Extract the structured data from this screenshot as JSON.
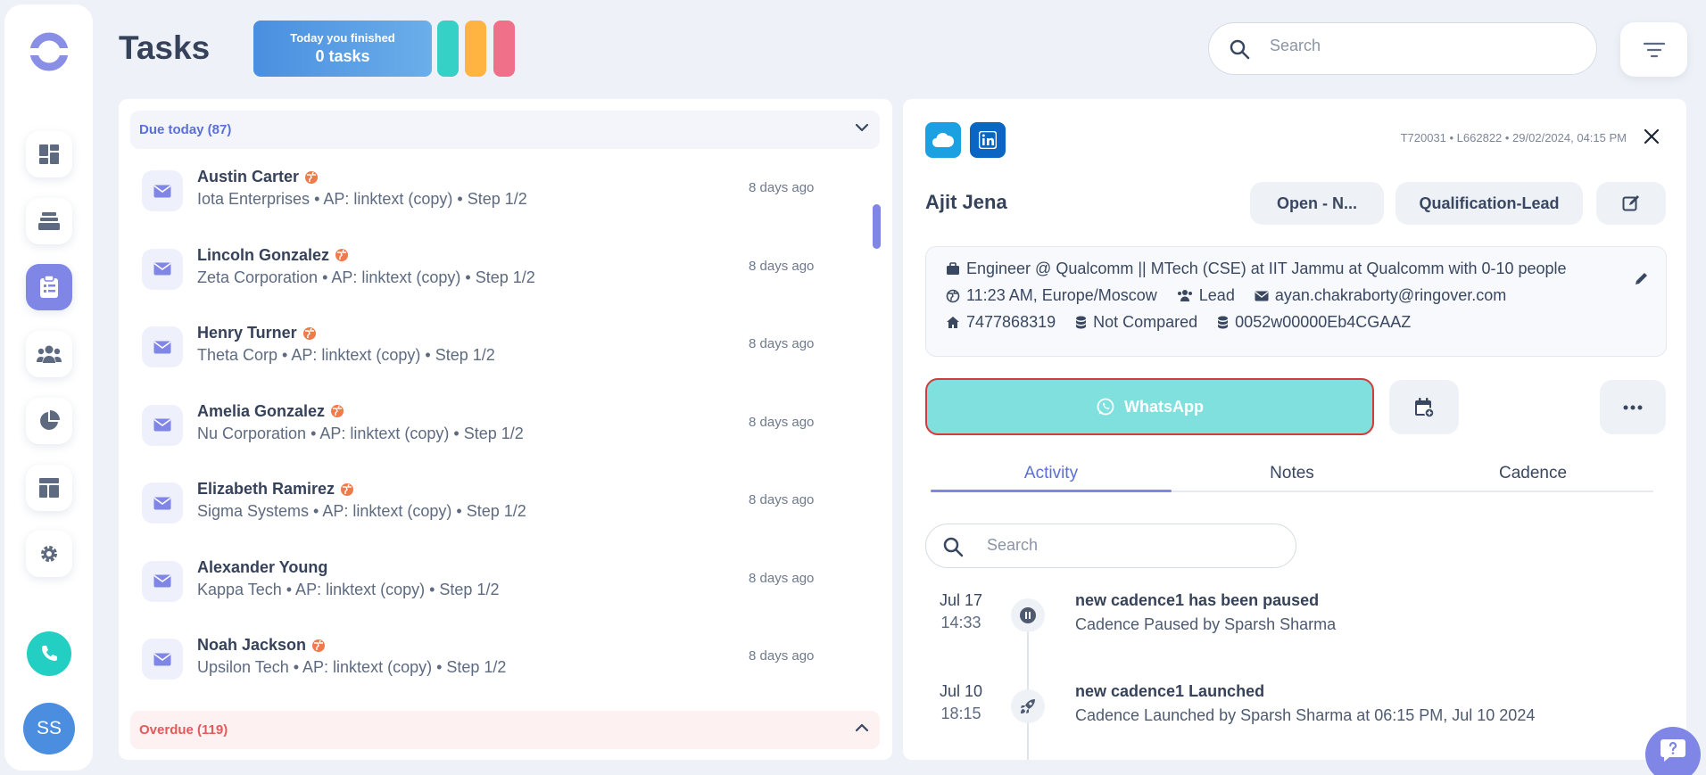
{
  "header": {
    "title": "Tasks",
    "today_line1": "Today you finished",
    "today_line2": "0 tasks",
    "search_placeholder": "Search"
  },
  "colors": {
    "accent": "#7f86e6",
    "pill_teal": "#35d0c6",
    "pill_orange": "#ffb340",
    "pill_pink": "#f0708a",
    "whatsapp": "#7fe0de",
    "phone": "#23cfc2"
  },
  "sidebar": {
    "avatar_initials": "SS",
    "items": [
      {
        "icon": "dashboard-icon"
      },
      {
        "icon": "layers-icon"
      },
      {
        "icon": "tasks-clipboard-icon",
        "active": true
      },
      {
        "icon": "people-icon"
      },
      {
        "icon": "pie-chart-icon"
      },
      {
        "icon": "template-icon"
      },
      {
        "icon": "gear-icon"
      }
    ]
  },
  "task_list": {
    "due_today_label": "Due today (87)",
    "overdue_label": "Overdue (119)",
    "tasks": [
      {
        "name": "Austin Carter",
        "sub": "Iota Enterprises • AP: linktext (copy) • Step 1/2",
        "time": "8 days ago",
        "globe": true
      },
      {
        "name": "Lincoln Gonzalez",
        "sub": "Zeta Corporation • AP: linktext (copy) • Step 1/2",
        "time": "8 days ago",
        "globe": true
      },
      {
        "name": "Henry Turner",
        "sub": "Theta Corp • AP: linktext (copy) • Step 1/2",
        "time": "8 days ago",
        "globe": true
      },
      {
        "name": "Amelia Gonzalez",
        "sub": "Nu Corporation • AP: linktext (copy) • Step 1/2",
        "time": "8 days ago",
        "globe": true
      },
      {
        "name": "Elizabeth Ramirez",
        "sub": "Sigma Systems • AP: linktext (copy) • Step 1/2",
        "time": "8 days ago",
        "globe": true
      },
      {
        "name": "Alexander Young",
        "sub": "Kappa Tech • AP: linktext (copy) • Step 1/2",
        "time": "8 days ago",
        "globe": false
      },
      {
        "name": "Noah Jackson",
        "sub": "Upsilon Tech • AP: linktext (copy) • Step 1/2",
        "time": "8 days ago",
        "globe": true
      }
    ]
  },
  "detail": {
    "meta": "T720031 • L662822 • 29/02/2024, 04:15 PM",
    "name": "Ajit Jena",
    "status_button": "Open - N...",
    "stage_button": "Qualification-Lead",
    "job": "Engineer @ Qualcomm || MTech (CSE) at IIT Jammu at Qualcomm with 0-10 people",
    "local_time": "11:23 AM, Europe/Moscow",
    "type": "Lead",
    "email": "ayan.chakraborty@ringover.com",
    "phone": "7477868319",
    "compare": "Not Compared",
    "crm_id": "0052w00000Eb4CGAAZ",
    "whatsapp_label": "WhatsApp",
    "tabs": [
      "Activity",
      "Notes",
      "Cadence"
    ],
    "activity_search_placeholder": "Search",
    "events": [
      {
        "date": "Jul 17",
        "time": "14:33",
        "title": "new cadence1 has been paused",
        "desc": "Cadence Paused by Sparsh Sharma",
        "icon": "pause-icon"
      },
      {
        "date": "Jul 10",
        "time": "18:15",
        "title": "new cadence1 Launched",
        "desc": "Cadence Launched by Sparsh Sharma at 06:15 PM, Jul 10 2024",
        "icon": "rocket-icon"
      }
    ]
  }
}
